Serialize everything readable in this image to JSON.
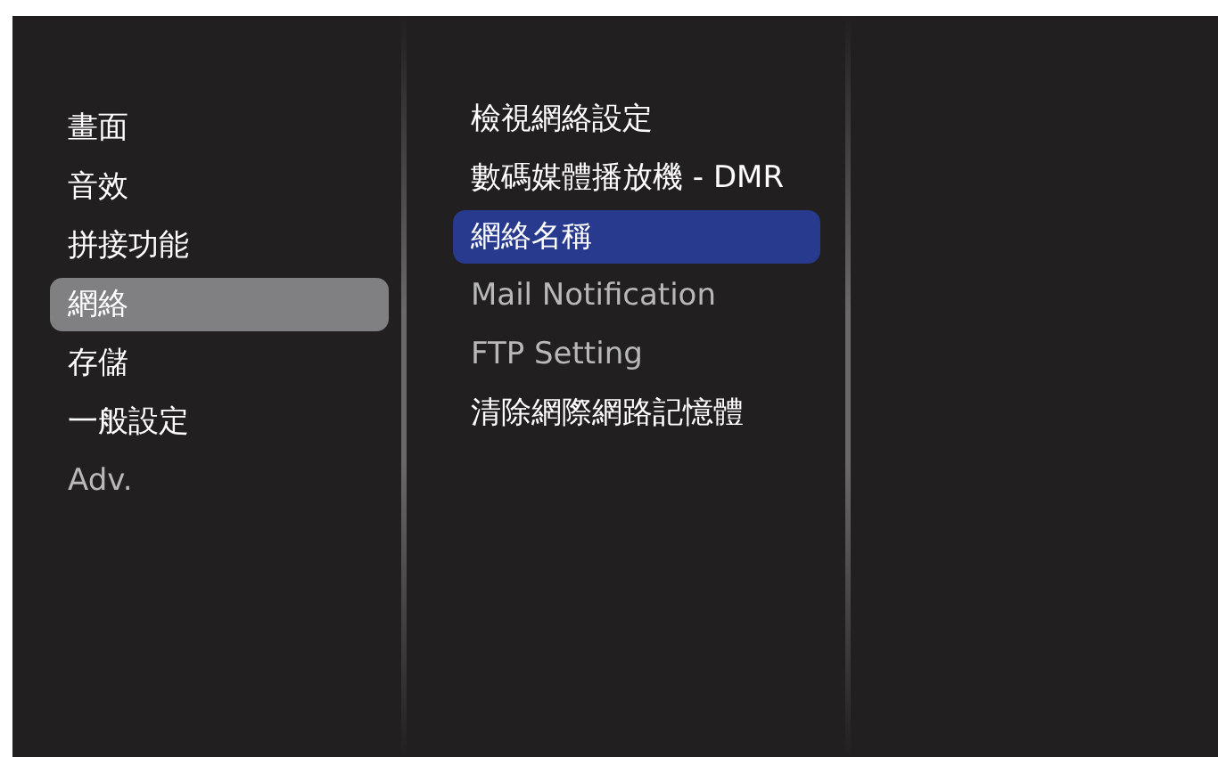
{
  "main_menu": [
    {
      "label": "畫面",
      "selected": false,
      "disabled": false
    },
    {
      "label": "音效",
      "selected": false,
      "disabled": false
    },
    {
      "label": "拼接功能",
      "selected": false,
      "disabled": false
    },
    {
      "label": "網絡",
      "selected": true,
      "disabled": false
    },
    {
      "label": "存儲",
      "selected": false,
      "disabled": false
    },
    {
      "label": "一般設定",
      "selected": false,
      "disabled": false
    },
    {
      "label": "Adv.",
      "selected": false,
      "disabled": true
    }
  ],
  "submenu": [
    {
      "label": "檢視網絡設定",
      "selected": false,
      "disabled": false
    },
    {
      "label": "數碼媒體播放機 - DMR",
      "selected": false,
      "disabled": false
    },
    {
      "label": "網絡名稱",
      "selected": true,
      "disabled": false
    },
    {
      "label": "Mail Notification",
      "selected": false,
      "disabled": true
    },
    {
      "label": "FTP Setting",
      "selected": false,
      "disabled": true
    },
    {
      "label": "清除網際網路記憶體",
      "selected": false,
      "disabled": false
    }
  ]
}
